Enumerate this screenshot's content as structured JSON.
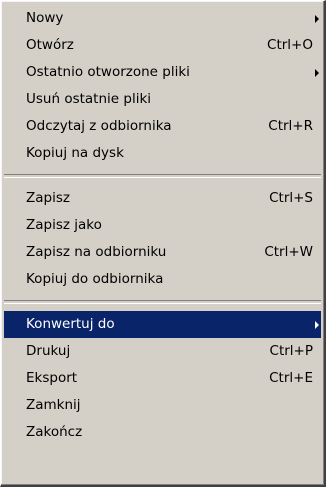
{
  "menu": {
    "groups": [
      {
        "items": [
          {
            "label": "Nowy",
            "shortcut": "",
            "submenu": true
          },
          {
            "label": "Otwórz",
            "shortcut": "Ctrl+O",
            "submenu": false
          },
          {
            "label": "Ostatnio otworzone pliki",
            "shortcut": "",
            "submenu": true
          },
          {
            "label": "Usuń ostatnie pliki",
            "shortcut": "",
            "submenu": false
          },
          {
            "label": "Odczytaj z odbiornika",
            "shortcut": "Ctrl+R",
            "submenu": false
          },
          {
            "label": "Kopiuj na dysk",
            "shortcut": "",
            "submenu": false
          }
        ]
      },
      {
        "items": [
          {
            "label": "Zapisz",
            "shortcut": "Ctrl+S",
            "submenu": false
          },
          {
            "label": "Zapisz jako",
            "shortcut": "",
            "submenu": false
          },
          {
            "label": "Zapisz na odbiorniku",
            "shortcut": "Ctrl+W",
            "submenu": false
          },
          {
            "label": "Kopiuj do odbiornika",
            "shortcut": "",
            "submenu": false
          }
        ]
      },
      {
        "items": [
          {
            "label": "Konwertuj do",
            "shortcut": "",
            "submenu": true,
            "highlighted": true
          },
          {
            "label": "Drukuj",
            "shortcut": "Ctrl+P",
            "submenu": false
          },
          {
            "label": "Eksport",
            "shortcut": "Ctrl+E",
            "submenu": false
          },
          {
            "label": "Zamknij",
            "shortcut": "",
            "submenu": false
          },
          {
            "label": "Zakończ",
            "shortcut": "",
            "submenu": false
          }
        ]
      }
    ],
    "colors": {
      "menu_background": "#d4d0c8",
      "highlight_background": "#0a246a",
      "highlight_text": "#ffffff",
      "text": "#000000"
    }
  }
}
